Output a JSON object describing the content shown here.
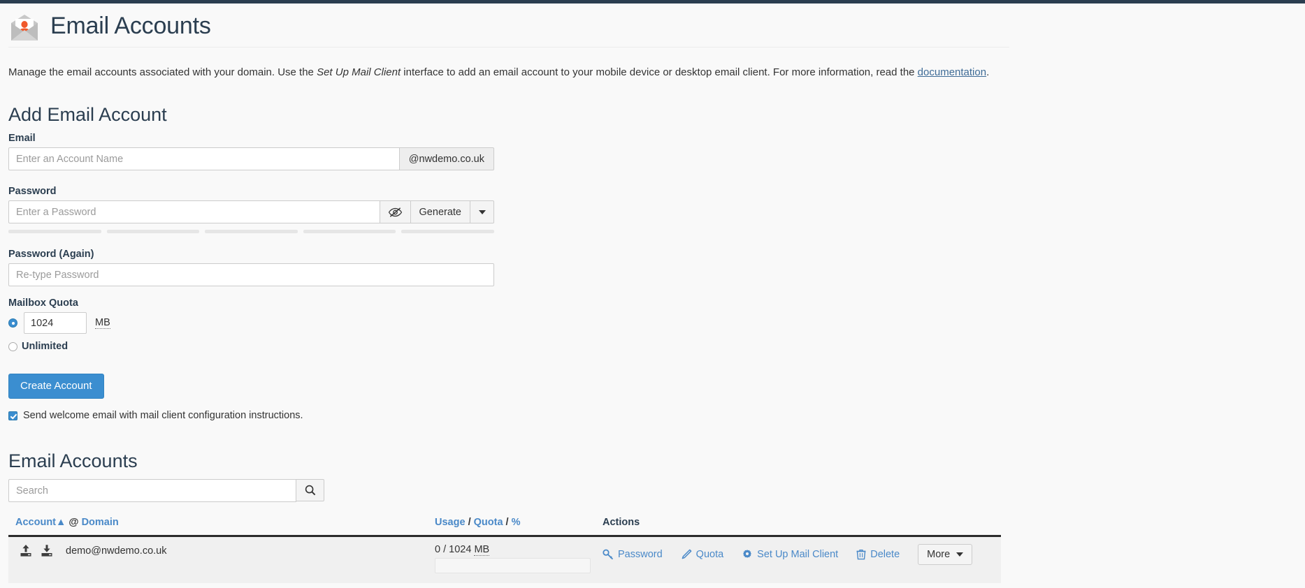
{
  "page": {
    "title": "Email Accounts",
    "icon": "email-account-icon",
    "intro_part1": "Manage the email accounts associated with your domain. Use the ",
    "intro_em": "Set Up Mail Client",
    "intro_part2": " interface to add an email account to your mobile device or desktop email client. For more information, read the ",
    "intro_link": "documentation",
    "intro_end": "."
  },
  "add_account": {
    "heading": "Add Email Account",
    "email_label": "Email",
    "email_placeholder": "Enter an Account Name",
    "email_value": "",
    "domain_suffix": "@nwdemo.co.uk",
    "password_label": "Password",
    "password_placeholder": "Enter a Password",
    "password_value": "",
    "show_password_icon": "eye-slash-icon",
    "generate_label": "Generate",
    "generate_caret_icon": "chevron-down-icon",
    "strength_segments": 5,
    "password_again_label": "Password (Again)",
    "password_again_placeholder": "Re-type Password",
    "password_again_value": "",
    "quota_label": "Mailbox Quota",
    "quota_value": "1024",
    "quota_unit": "MB",
    "quota_unlimited_label": "Unlimited",
    "quota_selected": "fixed",
    "create_button": "Create Account",
    "welcome_checkbox_label": "Send welcome email with mail client configuration instructions.",
    "welcome_checked": true
  },
  "accounts_section": {
    "heading": "Email Accounts",
    "search_placeholder": "Search",
    "search_value": "",
    "search_icon": "search-icon",
    "columns": {
      "account": "Account",
      "sort_indicator": "▲",
      "at": "@",
      "domain": "Domain",
      "usage": "Usage",
      "sep1": "/",
      "quota": "Quota",
      "sep2": "/",
      "percent": "%",
      "actions": "Actions"
    },
    "rows": [
      {
        "upload_icon": "upload-icon",
        "download_icon": "download-icon",
        "email": "demo@nwdemo.co.uk",
        "usage_used": "0",
        "usage_sep": "/",
        "usage_quota": "1024",
        "usage_unit": "MB",
        "usage_percent": 0,
        "actions": [
          {
            "label": "Password",
            "icon": "key-icon"
          },
          {
            "label": "Quota",
            "icon": "pencil-icon"
          },
          {
            "label": "Set Up Mail Client",
            "icon": "gear-icon"
          },
          {
            "label": "Delete",
            "icon": "trash-icon"
          }
        ],
        "more_label": "More",
        "more_icon": "chevron-down-icon"
      }
    ]
  },
  "colors": {
    "topbar": "#2b3e50",
    "accent": "#3b8ed0",
    "link": "#4a89c8",
    "icon_orange": "#f0592b",
    "background": "#f9f9f9"
  }
}
